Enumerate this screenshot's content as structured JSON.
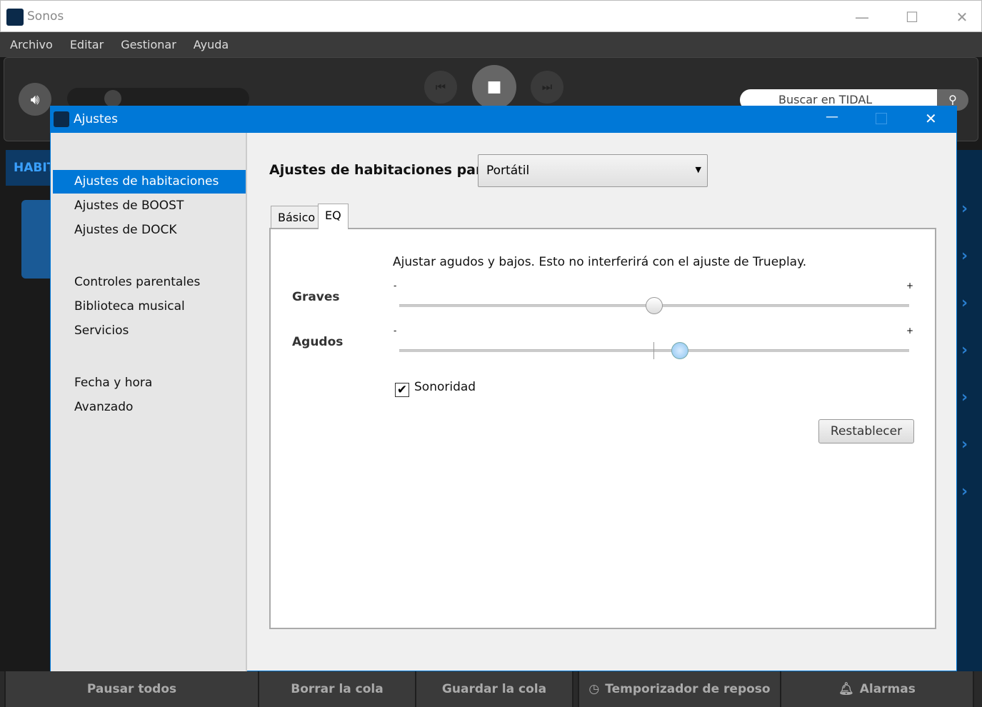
{
  "app": {
    "title": "Sonos",
    "logo_text": "SONOS"
  },
  "menu": [
    "Archivo",
    "Editar",
    "Gestionar",
    "Ayuda"
  ],
  "search": {
    "placeholder": "Buscar en TIDAL"
  },
  "rooms_header": "HABIT",
  "bottom": [
    "Pausar todos",
    "Borrar la cola",
    "Guardar la cola",
    "Temporizador de reposo",
    "Alarmas"
  ],
  "dialog": {
    "title": "Ajustes",
    "sidebar": [
      "Ajustes de habitaciones",
      "Ajustes de BOOST",
      "Ajustes de DOCK",
      "Controles parentales",
      "Biblioteca musical",
      "Servicios",
      "Fecha y hora",
      "Avanzado"
    ],
    "selected": 0,
    "heading": "Ajustes de habitaciones para",
    "room": "Portátil",
    "tabs": [
      "Básico",
      "EQ"
    ],
    "active_tab": "EQ",
    "description": "Ajustar agudos y bajos. Esto no interferirá con el ajuste de Trueplay.",
    "bass_label": "Graves",
    "treble_label": "Agudos",
    "minus": "-",
    "plus": "+",
    "bass_fraction": 0.5,
    "treble_fraction": 0.55,
    "loudness_label": "Sonoridad",
    "loudness_checked": true,
    "reset": "Restablecer"
  }
}
